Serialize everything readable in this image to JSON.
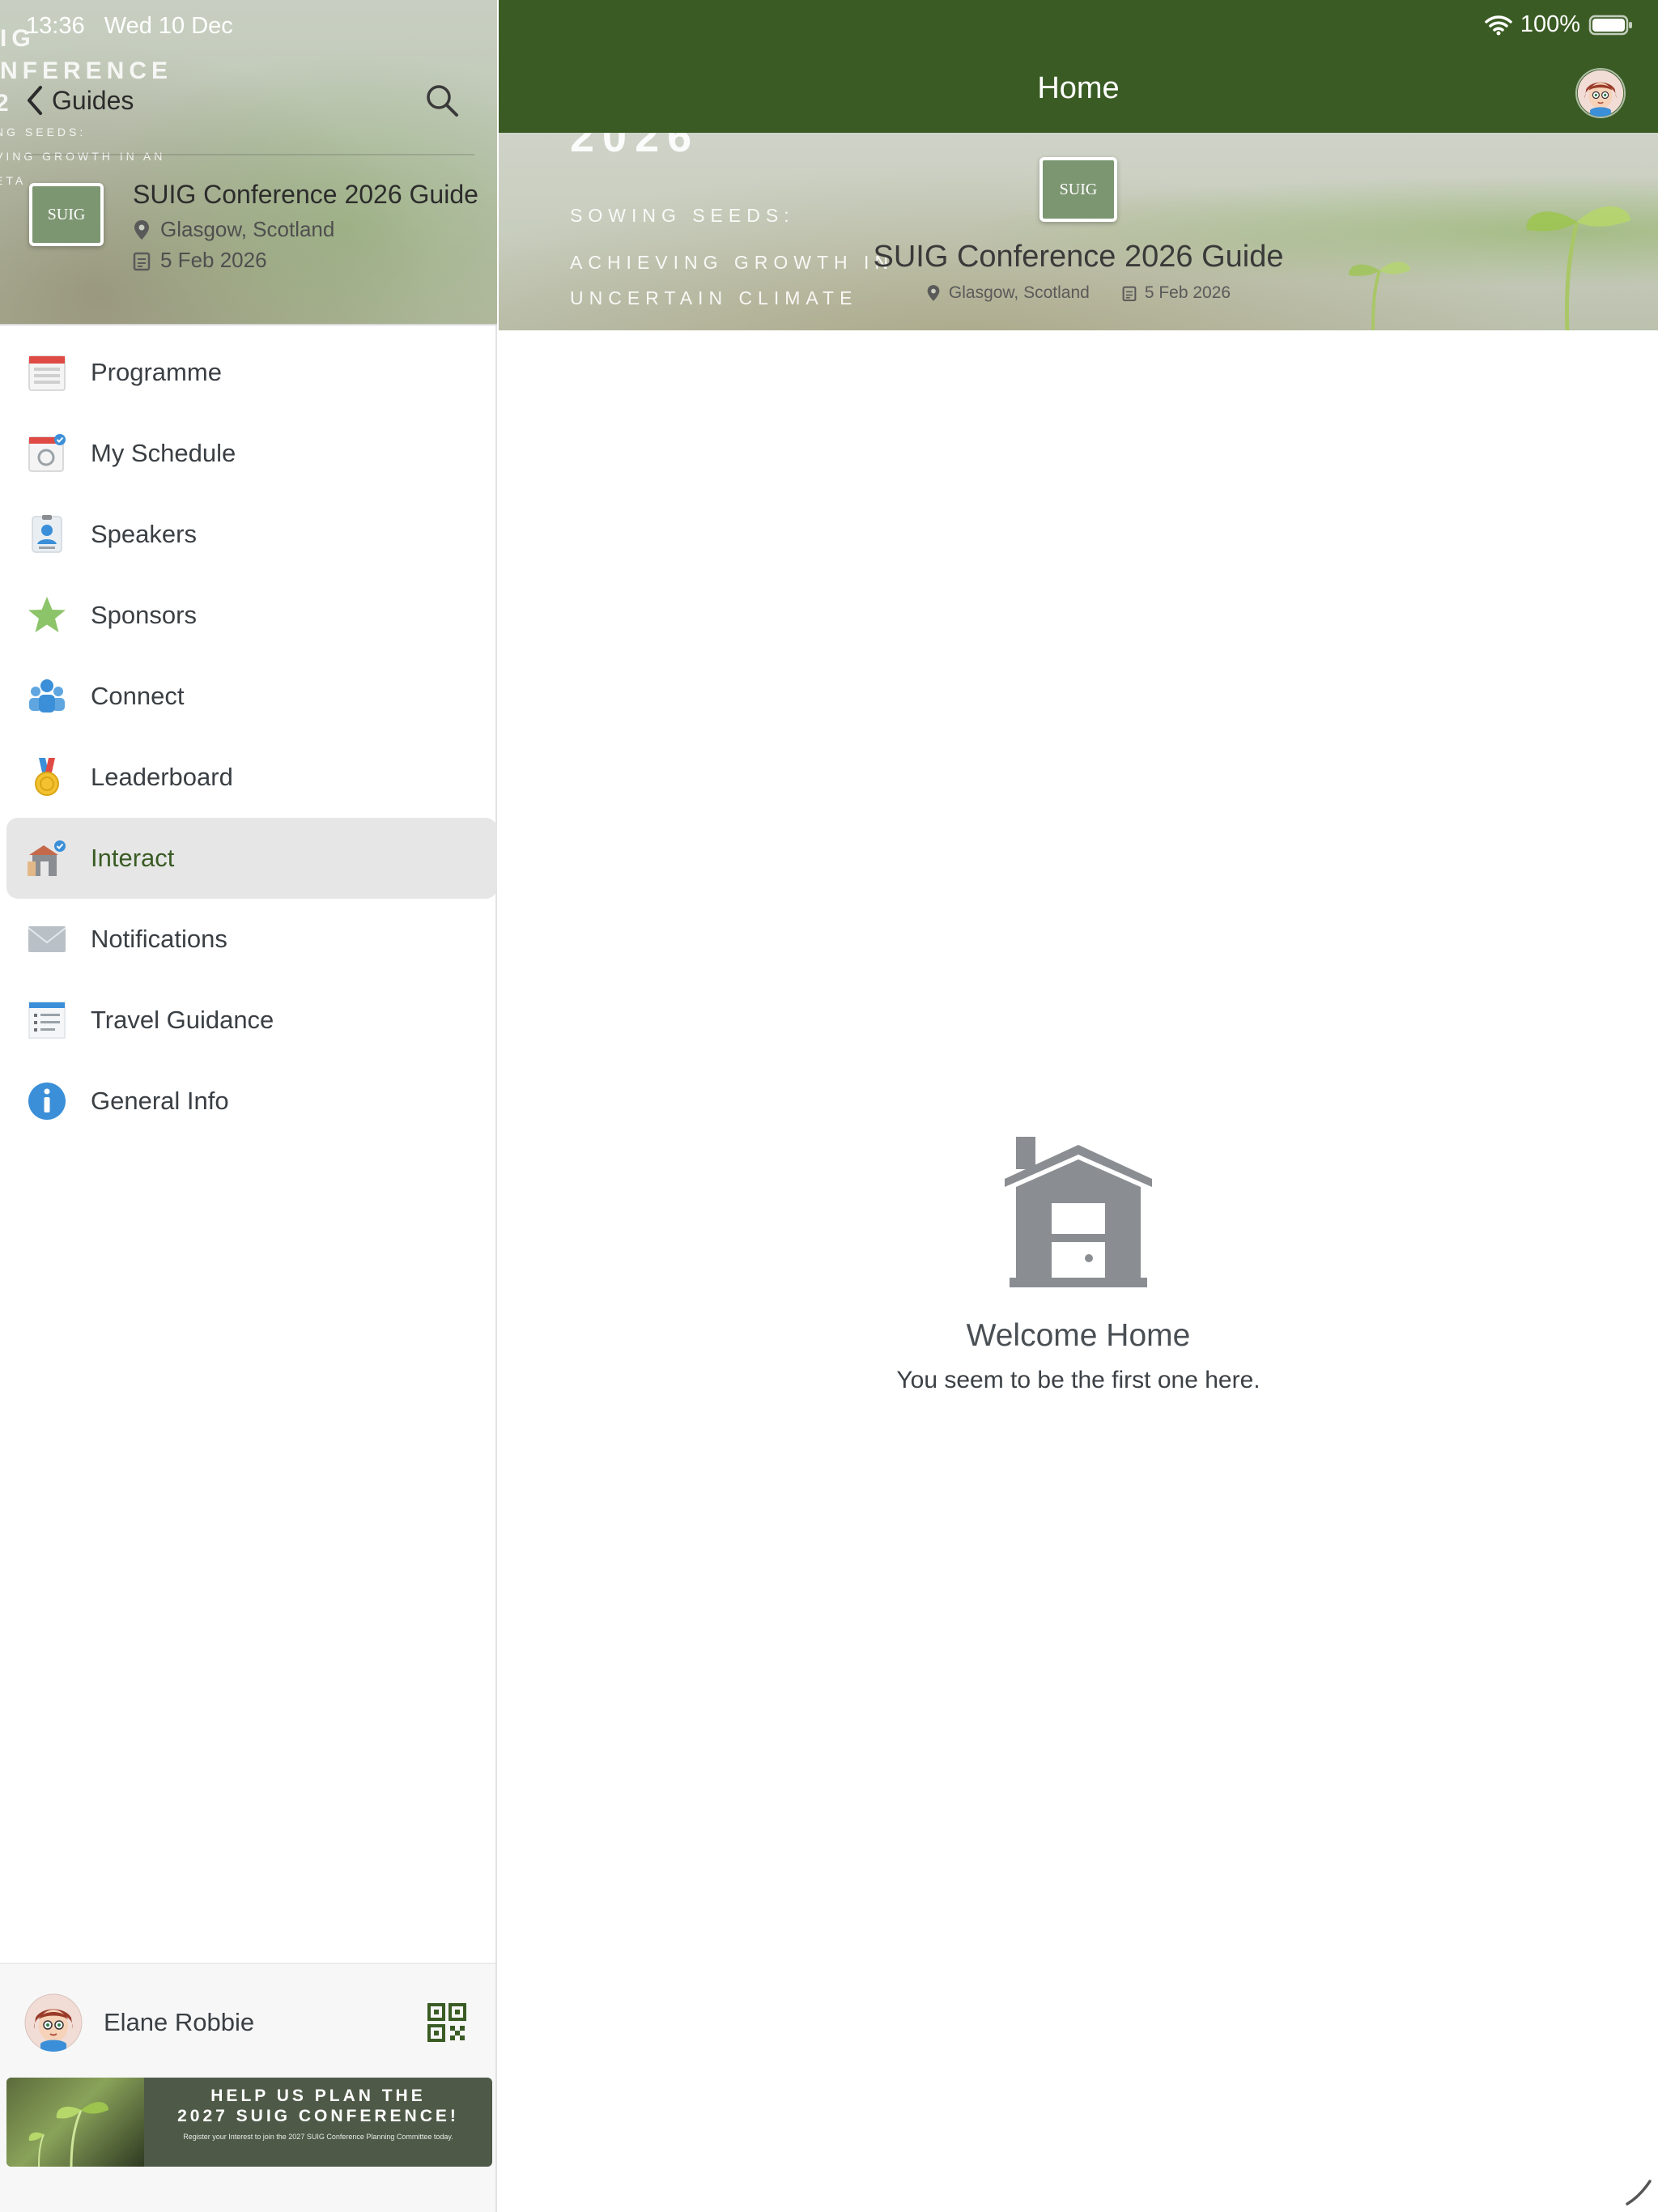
{
  "status_bar": {
    "time": "13:36",
    "date": "Wed 10 Dec",
    "battery": "100%"
  },
  "sidebar": {
    "hero_overlay": {
      "line1": "IG",
      "line2": "NFERENCE",
      "line3": "2",
      "line4": "NG SEEDS:",
      "line5": "VING GROWTH IN AN",
      "line6": "ETA"
    },
    "back_label": "Guides",
    "guide": {
      "logo_text": "SUIG",
      "title": "SUIG Conference 2026 Guide",
      "location": "Glasgow, Scotland",
      "date": "5 Feb 2026"
    },
    "items": [
      {
        "label": "Programme",
        "icon": "calendar-icon"
      },
      {
        "label": "My Schedule",
        "icon": "schedule-icon"
      },
      {
        "label": "Speakers",
        "icon": "speaker-badge-icon"
      },
      {
        "label": "Sponsors",
        "icon": "star-icon"
      },
      {
        "label": "Connect",
        "icon": "people-icon"
      },
      {
        "label": "Leaderboard",
        "icon": "medal-icon"
      },
      {
        "label": "Interact",
        "icon": "interact-icon",
        "active": true
      },
      {
        "label": "Notifications",
        "icon": "envelope-icon"
      },
      {
        "label": "Travel Guidance",
        "icon": "checklist-icon"
      },
      {
        "label": "General Info",
        "icon": "info-icon"
      }
    ],
    "footer": {
      "user_name": "Elane Robbie",
      "promo": {
        "headline1": "HELP US PLAN THE",
        "headline2": "2027 SUIG CONFERENCE!",
        "sub": "Register your Interest to join the 2027 SUIG Conference Planning Committee today."
      }
    }
  },
  "main": {
    "title": "Home",
    "hero": {
      "bg_year": "2026",
      "bg_line1": "SOWING SEEDS:",
      "bg_line2": "ACHIEVING GROWTH IN",
      "bg_line3": "UNCERTAIN CLIMATE",
      "logo_text": "SUIG",
      "title": "SUIG Conference 2026 Guide",
      "location": "Glasgow, Scotland",
      "date": "5 Feb 2026"
    },
    "empty_state": {
      "title": "Welcome Home",
      "subtitle": "You seem to be the first one here."
    }
  },
  "colors": {
    "brand_green": "#3a5c24",
    "icon_gray": "#8a8e92",
    "active_bg": "#e6e6e6"
  }
}
